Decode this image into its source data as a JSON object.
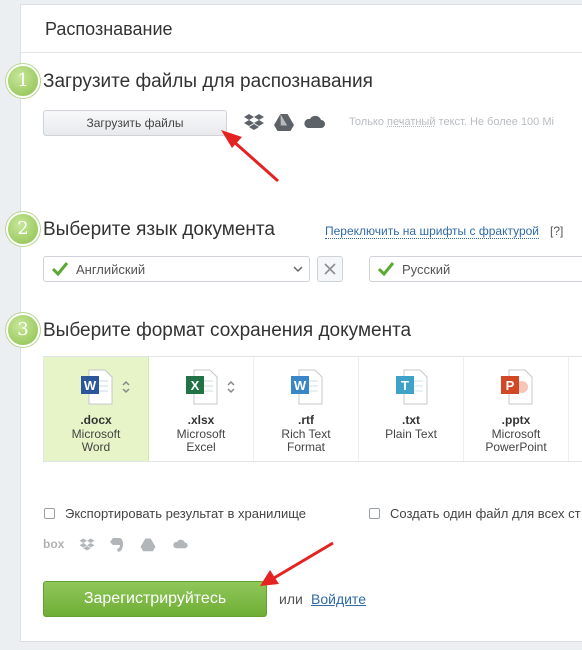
{
  "panel": {
    "title": "Распознавание"
  },
  "steps": [
    {
      "number": "1",
      "title": "Загрузите файлы для распознавания"
    },
    {
      "number": "2",
      "title": "Выберите язык документа"
    },
    {
      "number": "3",
      "title": "Выберите формат сохранения документа"
    }
  ],
  "upload": {
    "button_label": "Загрузить файлы",
    "icons": [
      "dropbox-icon",
      "google-drive-icon",
      "onedrive-icon"
    ],
    "hint_prefix": "Только ",
    "hint_underlined": "печатный",
    "hint_suffix": " текст. Не более 100 Mi"
  },
  "language": {
    "fraktur_link": "Переключить на шрифты с фрактурой",
    "help": "[?]",
    "primary": "Английский",
    "secondary": "Русский"
  },
  "formats": [
    {
      "ext": ".docx",
      "line1": "Microsoft",
      "line2": "Word",
      "letter": "W",
      "color": "#2b579a",
      "selected": true,
      "has_arrows": true
    },
    {
      "ext": ".xlsx",
      "line1": "Microsoft",
      "line2": "Excel",
      "letter": "X",
      "color": "#217346",
      "selected": false,
      "has_arrows": true
    },
    {
      "ext": ".rtf",
      "line1": "Rich Text",
      "line2": "Format",
      "letter": "W",
      "color": "#3a87c8",
      "selected": false,
      "has_arrows": false
    },
    {
      "ext": ".txt",
      "line1": "Plain Text",
      "line2": "",
      "letter": "T",
      "color": "#3fa3c9",
      "selected": false,
      "has_arrows": false
    },
    {
      "ext": ".pptx",
      "line1": "Microsoft",
      "line2": "PowerPoint",
      "letter": "P",
      "color": "#d24726",
      "selected": false,
      "has_arrows": false
    }
  ],
  "options": {
    "export_label": "Экспортировать результат в хранилище",
    "single_file_label": "Создать один файл для всех ст",
    "storage_icons": [
      "box-icon",
      "dropbox-icon",
      "evernote-icon",
      "google-drive-icon",
      "onedrive-icon"
    ],
    "box_text": "box"
  },
  "footer": {
    "register_label": "Зарегистрируйтесь",
    "or_text": "или",
    "login_label": "Войдите"
  },
  "colors": {
    "accent_green": "#6fae35",
    "link_blue": "#2f6aa7",
    "selected_bg": "#e7f4c7",
    "arrow_red": "#e52222"
  }
}
